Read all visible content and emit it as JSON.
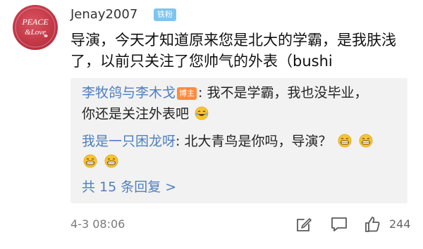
{
  "comment": {
    "avatar_text_top": "PEACE",
    "avatar_text_bottom": "&Love",
    "username": "Jenay2007",
    "fan_badge": "铁粉",
    "text": "导演，今天才知道原来您是北大的学霸，是我肤浅了，以前只关注了您帅气的外表（bushi",
    "timestamp": "4-3 08:06",
    "like_count": "244",
    "icons": [
      "edit-icon",
      "comment-icon",
      "thumbs-up-icon"
    ]
  },
  "replies": {
    "reply1_name": "李牧鸽与李木戈",
    "reply1_badge": "博主",
    "reply1_text_a": ": 我不是学霸，我也没毕业，",
    "reply1_text_b": "你还是关注外表吧",
    "reply2_name": "我是一只困龙呀",
    "reply2_text": ": 北大青鸟是你吗，导演？",
    "more_label": "共 15 条回复 >"
  }
}
